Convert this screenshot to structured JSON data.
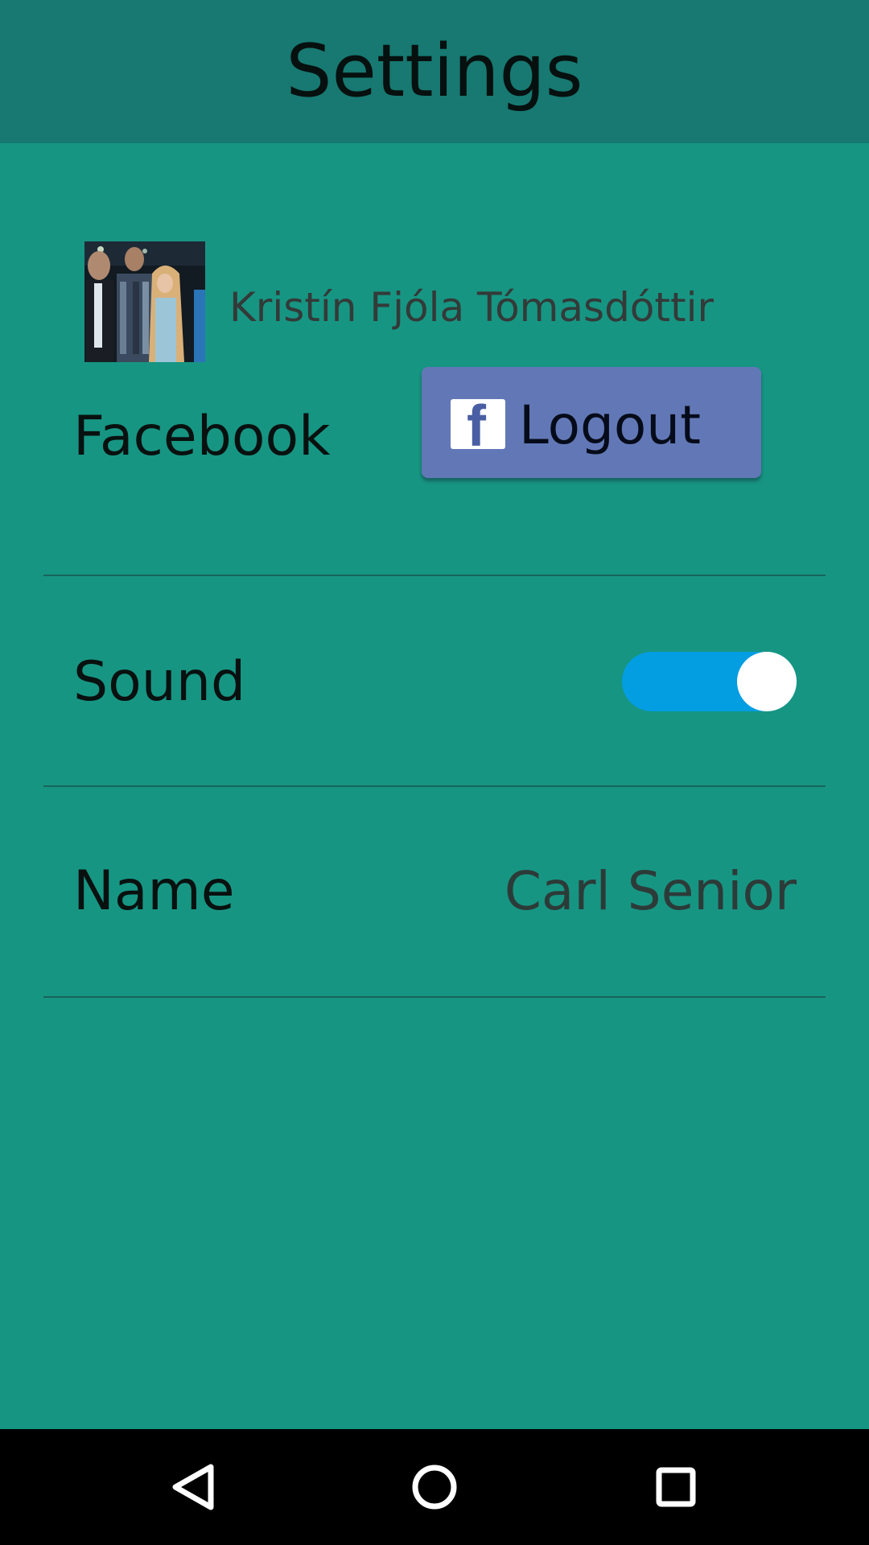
{
  "app_bar": {
    "title": "Settings"
  },
  "profile": {
    "name": "Kristín Fjóla Tómasdóttir",
    "avatar": "profile-photo"
  },
  "facebook": {
    "label": "Facebook",
    "button_label": "Logout",
    "button_icon": "facebook-f-icon",
    "button_color": "#6278b6"
  },
  "sound": {
    "label": "Sound",
    "enabled": true,
    "toggle_color": "#039de2"
  },
  "name_setting": {
    "label": "Name",
    "value": "Carl Senior"
  },
  "nav": {
    "back_icon": "back-triangle-icon",
    "home_icon": "home-circle-icon",
    "recents_icon": "recents-square-icon"
  },
  "colors": {
    "background": "#179583",
    "app_bar": "#177971"
  }
}
